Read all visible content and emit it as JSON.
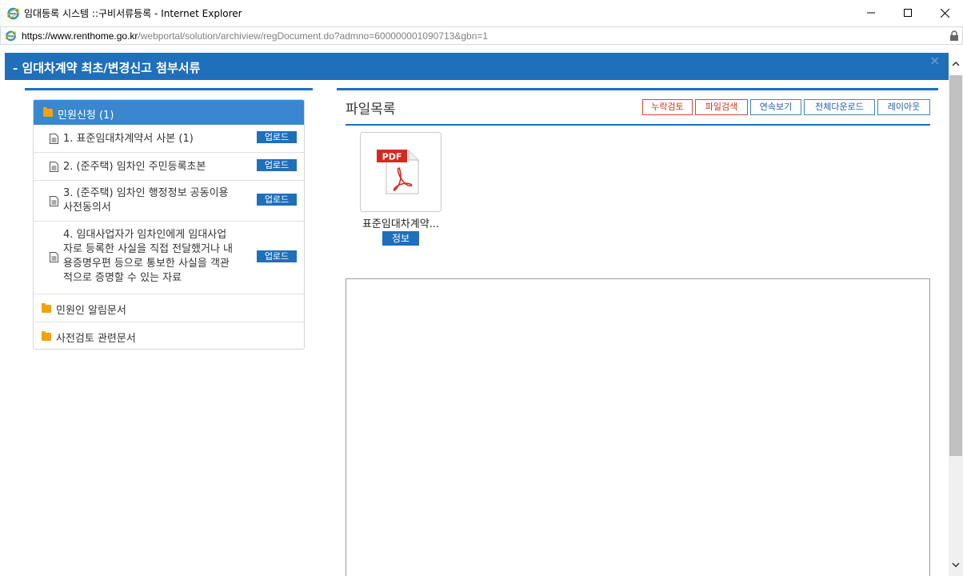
{
  "window": {
    "title": "임대등록 시스템 ::구비서류등록 - Internet Explorer",
    "url_proto": "https://www.",
    "url_host": "renthome.go.kr",
    "url_path": "/webportal/solution/archiview/regDocument.do?admno=600000001090713&gbn=1"
  },
  "popup": {
    "title": "- 임대차계약 최초/변경신고 첨부서류",
    "close": "×"
  },
  "tree": {
    "root_label": "민원신청 (1)",
    "upload_label": "업로드",
    "items": [
      {
        "label": "1. 표준임대차계약서 사본 (1)"
      },
      {
        "label": "2. (준주택) 임차인 주민등록초본"
      },
      {
        "label_l1": "3. (준주택) 임차인 행정정보 공동이용",
        "label_l2": "사전동의서"
      },
      {
        "label_l1": "4. 임대사업자가 임차인에게 임대사업",
        "label_l2": "자로 등록한 사실을 직접 전달했거나 내",
        "label_l3": "용증명우편 등으로 통보한 사실을 객관",
        "label_l4": "적으로 증명할 수 있는 자료"
      }
    ],
    "folders": [
      {
        "label": "민원인 알림문서"
      },
      {
        "label": "사전검토 관련문서"
      }
    ]
  },
  "file_list": {
    "title": "파일목록",
    "buttons": [
      "누락검토",
      "파일검색",
      "연속보기",
      "전체다운로드",
      "레이아웃"
    ],
    "files": [
      {
        "name": "표준임대차계약...",
        "type": "PDF",
        "info_label": "정보"
      }
    ]
  },
  "colors": {
    "accent": "#1f6fbb",
    "folder": "#f0a30a",
    "warn": "#c0391b",
    "pdf_red": "#d42a1f"
  }
}
